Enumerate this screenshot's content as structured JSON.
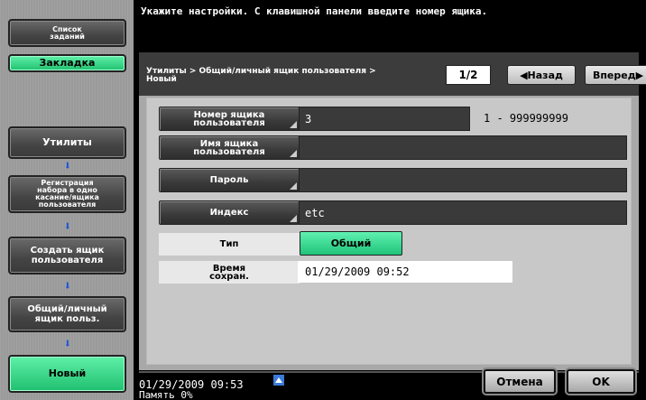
{
  "sidebar": {
    "job_list": "Список\nзаданий",
    "bookmark": "Закладка",
    "utilities": "Утилиты",
    "registration": "Регистрация\nнабора в одно\nкасание/ящика\nпользователя",
    "create_box": "Создать ящик\nпользователя",
    "public_box": "Общий/личный\nящик польз.",
    "new": "Новый"
  },
  "message": "Укажите настройки. С клавишной панели введите номер ящика.",
  "header": {
    "breadcrumb": "Утилиты > Общий/личный ящик пользователя >\nНовый",
    "page_indicator": "1/2",
    "back_label": "◀Назад",
    "forward_label": "Вперед▶"
  },
  "fields": {
    "box_number": {
      "label": "Номер ящика\nпользователя",
      "value": "3",
      "range": "1 - 999999999"
    },
    "box_name": {
      "label": "Имя ящика\nпользователя",
      "value": ""
    },
    "password": {
      "label": "Пароль",
      "value": ""
    },
    "index": {
      "label": "Индекс",
      "value": "etc"
    },
    "type": {
      "label": "Тип",
      "value": "Общий"
    },
    "save_time": {
      "label": "Время\nсохран.",
      "value": "01/29/2009   09:52"
    }
  },
  "footer": {
    "clock": "01/29/2009   09:53",
    "memory": "Память        0%",
    "cancel_label": "Отмена",
    "ok_label": "OK"
  },
  "colors": {
    "accent_green": "#2fd88a",
    "arrow_blue": "#1a55d8"
  }
}
